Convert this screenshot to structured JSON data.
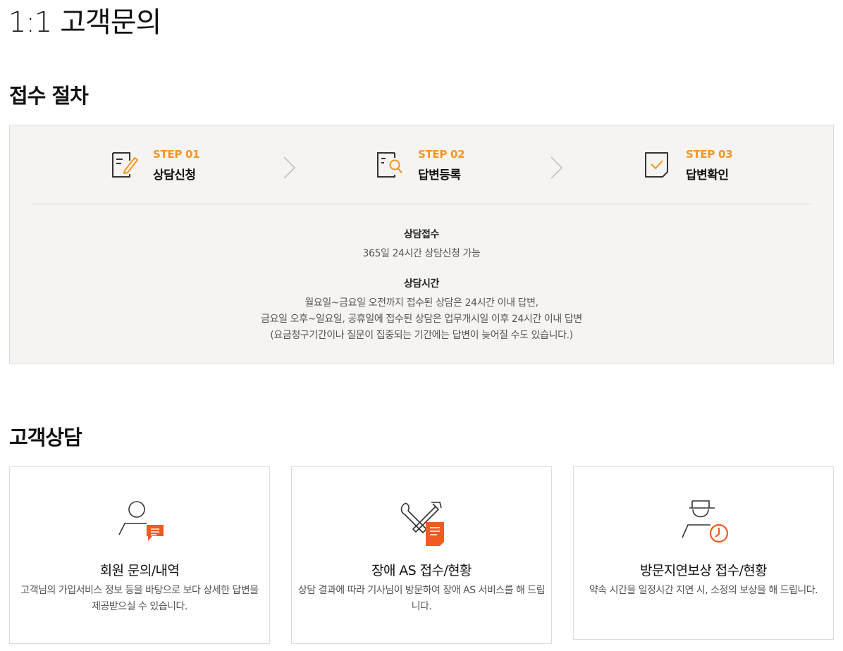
{
  "page": {
    "title": "1:1 고객문의"
  },
  "procedure": {
    "title": "접수 절차",
    "steps": [
      {
        "num": "STEP 01",
        "label": "상담신청",
        "icon": "edit-document-icon"
      },
      {
        "num": "STEP 02",
        "label": "답변등록",
        "icon": "search-document-icon"
      },
      {
        "num": "STEP 03",
        "label": "답변확인",
        "icon": "check-document-icon"
      }
    ],
    "reception": {
      "heading": "상담접수",
      "text": "365일 24시간 상담신청 가능"
    },
    "hours": {
      "heading": "상담시간",
      "lines": [
        "월요일~금요일 오전까지 접수된 상담은 24시간 이내 답변,",
        "금요일 오후~일요일, 공휴일에 접수된 상담은 업무개시일 이후 24시간 이내 답변",
        "(요금청구기간이나 질문이 집중되는 기간에는 답변이 늦어질 수도 있습니다.)"
      ]
    }
  },
  "consult": {
    "title": "고객상담",
    "cards": [
      {
        "title": "회원 문의/내역",
        "desc": "고객님의 가입서비스 정보 등을 바탕으로 보다 상세한 답변을 제공받으실 수 있습니다.",
        "icon": "member-chat-icon"
      },
      {
        "title": "장애 AS 접수/현황",
        "desc": "상담 결과에 따라 기사님이 방문하여 장애 AS 서비스를 해 드립니다.",
        "icon": "repair-tools-icon"
      },
      {
        "title": "방문지연보상 접수/현황",
        "desc": "약속 시간을 일정시간 지연 시, 소정의 보상을 해 드립니다.",
        "icon": "technician-clock-icon"
      }
    ]
  },
  "colors": {
    "accent": "#f7941d",
    "icon_orange": "#f15a22",
    "box_bg": "#f5f4f2"
  }
}
